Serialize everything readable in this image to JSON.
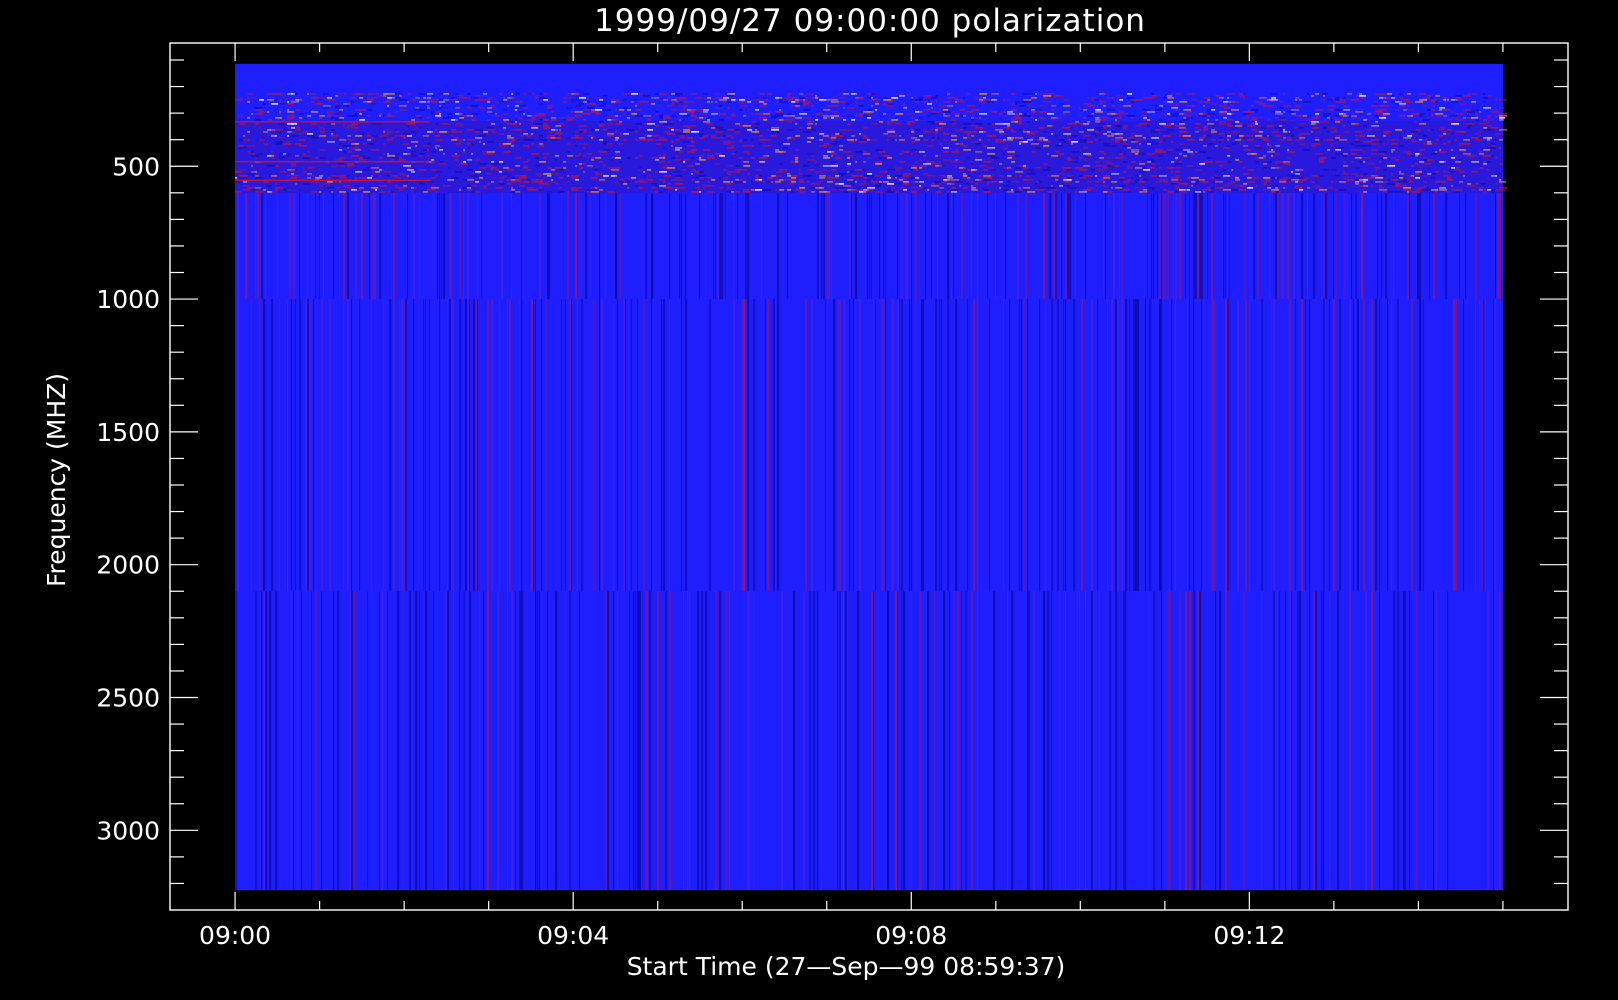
{
  "chart_data": {
    "type": "heatmap",
    "title": "1999/09/27 09:00:00 polarization",
    "xlabel": "Start Time (27—Sep—99 08:59:37)",
    "ylabel": "Frequency (MHZ)",
    "x_ticks": [
      {
        "label": "09:00",
        "minutes": 0
      },
      {
        "label": "09:04",
        "minutes": 4
      },
      {
        "label": "09:08",
        "minutes": 8
      },
      {
        "label": "09:12",
        "minutes": 12
      }
    ],
    "y_ticks": [
      {
        "label": "500",
        "value": 500
      },
      {
        "label": "1000",
        "value": 1000
      },
      {
        "label": "1500",
        "value": 1500
      },
      {
        "label": "2000",
        "value": 2000
      },
      {
        "label": "2500",
        "value": 2500
      },
      {
        "label": "3000",
        "value": 3000
      }
    ],
    "x_range_minutes": [
      -0.77,
      15.77
    ],
    "y_range_mhz": [
      3300,
      36
    ],
    "y_inverted": true,
    "data_extent": {
      "x_minutes": [
        0,
        15.0
      ],
      "y_mhz": [
        115,
        3225
      ]
    },
    "frequency_bands_mhz": [
      {
        "from": 115,
        "to": 600,
        "pattern": "striped"
      },
      {
        "from": 600,
        "to": 1000,
        "pattern": "vertical"
      },
      {
        "from": 1000,
        "to": 2100,
        "pattern": "vertical"
      },
      {
        "from": 2100,
        "to": 3225,
        "pattern": "vertical"
      }
    ],
    "colors": {
      "background": "#000000",
      "base": "#1e1eff",
      "dark": "#0c0ca8",
      "red": "#d01030",
      "orange": "#ff9a2a",
      "white": "#ffffff",
      "axis": "#ffffff"
    },
    "grid": false
  }
}
